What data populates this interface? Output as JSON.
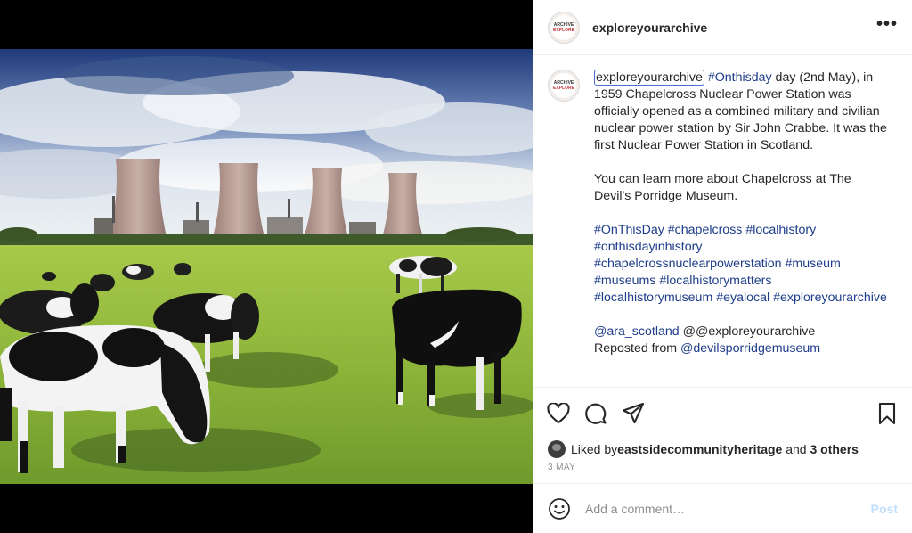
{
  "header": {
    "username": "exploreyourarchive",
    "more_label": "•••"
  },
  "avatar": {
    "line1": "ARCHIVE",
    "line2": "EXPLORE"
  },
  "caption": {
    "username": "exploreyourarchive",
    "p1_tag": "#Onthisday",
    "p1_text": " day (2nd May), in 1959 Chapelcross Nuclear Power Station was officially opened as a combined military and civilian nuclear power station by Sir John Crabbe. It was the first Nuclear Power Station in Scotland.",
    "p2_text": "You can learn more about Chapelcross at The Devil's Porridge Museum.",
    "hashtags": "#OnThisDay #chapelcross #localhistory #onthisdayinhistory #chapelcrossnuclearpowerstation #museum #museums #localhistorymatters #localhistorymuseum #eyalocal #exploreyourarchive",
    "mention": "@ara_scotland",
    "mention_rest": " @@exploreyourarchive",
    "repost_prefix": "Reposted from ",
    "repost_mention": "@devilsporridgemuseum"
  },
  "likes": {
    "prefix": "Liked by ",
    "user": "eastsidecommunityheritage",
    "mid": " and ",
    "others": "3 others"
  },
  "date": "3 MAY",
  "comment": {
    "placeholder": "Add a comment…",
    "post_label": "Post"
  },
  "colors": {
    "hashtag": "#1e3d8a",
    "post_disabled": "#c0dffd",
    "muted": "#8e8e8e"
  }
}
